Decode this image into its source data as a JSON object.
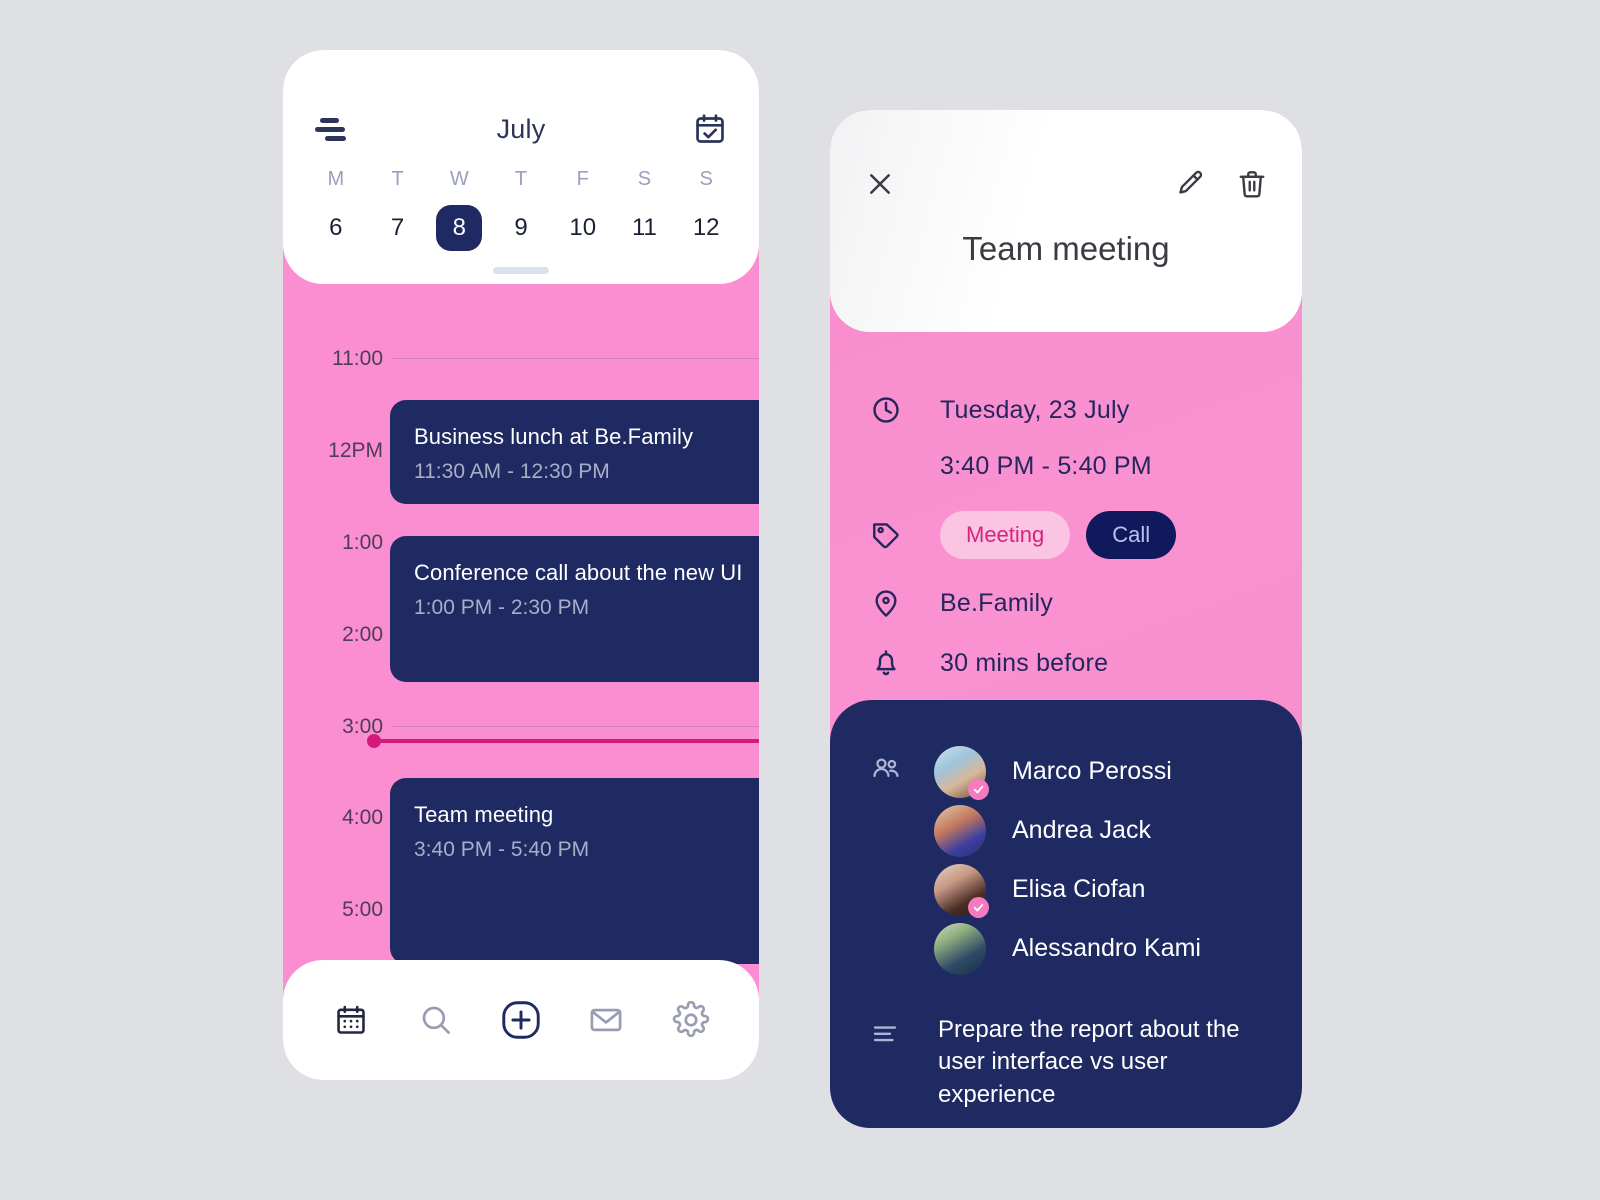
{
  "calendar": {
    "month": "July",
    "menu_icon": "hamburger-menu-icon",
    "calendar_check_icon": "calendar-check-icon",
    "weekdays": [
      "M",
      "T",
      "W",
      "T",
      "F",
      "S",
      "S"
    ],
    "days": [
      {
        "num": "6",
        "selected": false
      },
      {
        "num": "7",
        "selected": false
      },
      {
        "num": "8",
        "selected": true
      },
      {
        "num": "9",
        "selected": false
      },
      {
        "num": "10",
        "selected": false
      },
      {
        "num": "11",
        "selected": false
      },
      {
        "num": "12",
        "selected": false
      }
    ],
    "hours": [
      "11:00",
      "12PM",
      "1:00",
      "2:00",
      "3:00",
      "4:00",
      "5:00"
    ],
    "events": [
      {
        "title": "Business lunch at Be.Family",
        "time": "11:30 AM - 12:30 PM"
      },
      {
        "title": "Conference call about the new UI",
        "time": "1:00 PM - 2:30 PM"
      },
      {
        "title": "Team meeting",
        "time": "3:40 PM - 5:40 PM"
      }
    ],
    "nav": [
      {
        "name": "calendar",
        "icon": "calendar-icon",
        "active": true
      },
      {
        "name": "search",
        "icon": "search-icon",
        "active": false
      },
      {
        "name": "add",
        "icon": "plus-circle-icon",
        "active": false
      },
      {
        "name": "mail",
        "icon": "mail-icon",
        "active": false
      },
      {
        "name": "settings",
        "icon": "gear-icon",
        "active": false
      }
    ]
  },
  "detail": {
    "close_icon": "close-icon",
    "edit_icon": "pencil-icon",
    "delete_icon": "trash-icon",
    "title": "Team meeting",
    "date": "Tuesday, 23 July",
    "time": "3:40 PM - 5:40 PM",
    "tags": [
      {
        "label": "Meeting",
        "style": "meeting"
      },
      {
        "label": "Call",
        "style": "call"
      }
    ],
    "location": "Be.Family",
    "reminder": "30 mins before",
    "attendees": [
      {
        "name": "Marco Perossi",
        "confirmed": true
      },
      {
        "name": "Andrea Jack",
        "confirmed": false
      },
      {
        "name": "Elisa Ciofan",
        "confirmed": true
      },
      {
        "name": "Alessandro  Kami",
        "confirmed": false
      }
    ],
    "notes": "Prepare the report about the user interface vs user experience"
  },
  "colors": {
    "pink": "#fa8ed0",
    "navy": "#1f2a62",
    "magenta": "#d61a7c",
    "background": "#dee0e4",
    "chip_pink_bg": "#fbc4e2",
    "chip_pink_text": "#d6247e"
  }
}
